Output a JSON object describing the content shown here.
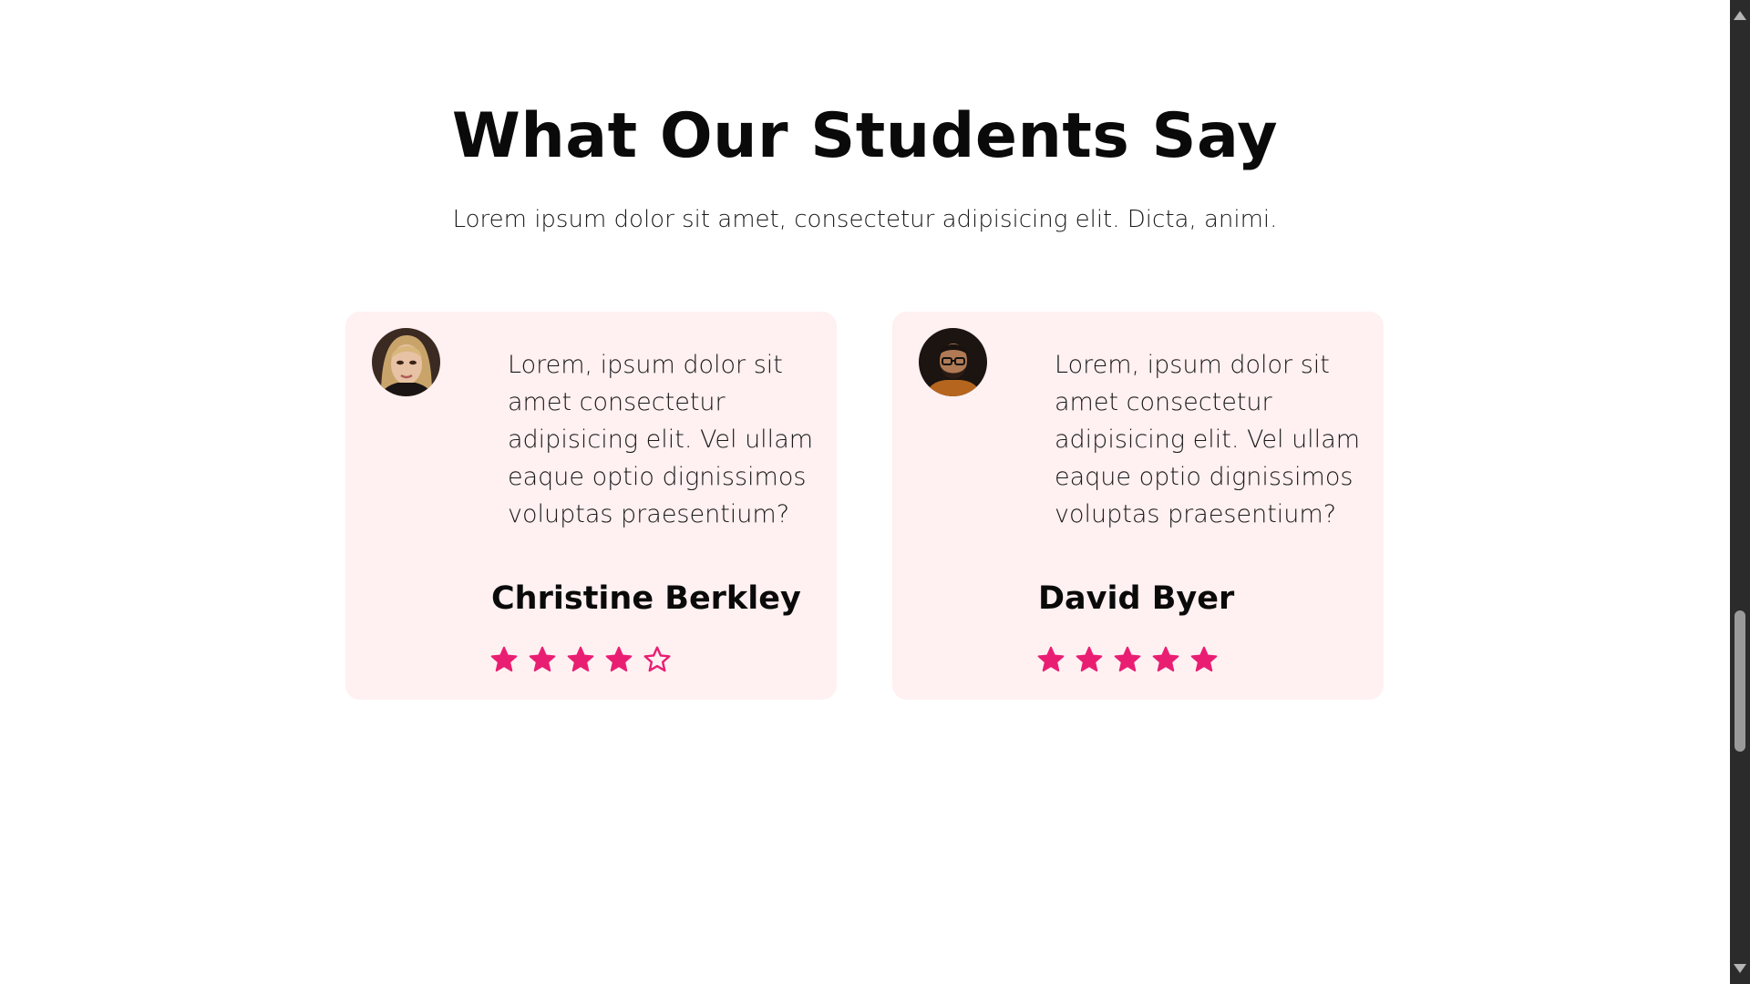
{
  "section": {
    "title": "What Our Students Say",
    "subtitle": "Lorem ipsum dolor sit amet, consectetur adipisicing elit. Dicta, animi."
  },
  "testimonials": [
    {
      "text": "Lorem, ipsum dolor sit amet consectetur adipisicing elit. Vel ullam eaque optio dignissimos voluptas praesentium?",
      "name": "Christine Berkley",
      "rating": 4,
      "rating_max": 5,
      "avatar": "woman-avatar-photo"
    },
    {
      "text": "Lorem, ipsum dolor sit amet consectetur adipisicing elit. Vel ullam eaque optio dignissimos voluptas praesentium?",
      "name": "David Byer",
      "rating": 5,
      "rating_max": 5,
      "avatar": "man-avatar-photo"
    }
  ],
  "colors": {
    "card_background": "#fff0f1",
    "star": "#e91e73",
    "title": "#0a0a0a",
    "scrollbar_track": "#2b2b2b",
    "scrollbar_thumb": "#9a9a9a"
  }
}
